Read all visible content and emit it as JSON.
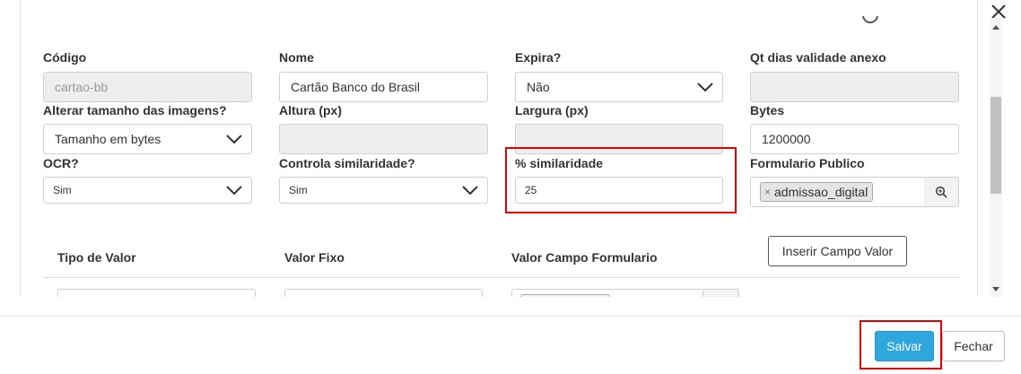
{
  "form": {
    "row1": {
      "codigo": {
        "label": "Código",
        "value": "cartao-bb"
      },
      "nome": {
        "label": "Nome",
        "value": "Cartão Banco do Brasil"
      },
      "expira": {
        "label": "Expira?",
        "value": "Não"
      },
      "qt_dias": {
        "label": "Qt dias validade anexo",
        "value": ""
      }
    },
    "row2": {
      "alterar_tamanho": {
        "label": "Alterar tamanho das imagens?",
        "value": "Tamanho em bytes"
      },
      "altura": {
        "label": "Altura (px)",
        "value": ""
      },
      "largura": {
        "label": "Largura (px)",
        "value": ""
      },
      "bytes": {
        "label": "Bytes",
        "value": "1200000"
      }
    },
    "row3": {
      "ocr": {
        "label": "OCR?",
        "value": "Sim"
      },
      "controla_similaridade": {
        "label": "Controla similaridade?",
        "value": "Sim"
      },
      "similaridade": {
        "label": "% similaridade",
        "value": "25"
      },
      "formulario_publico": {
        "label": "Formulario Publico",
        "tag_remove": "×",
        "tag": "admissao_digital"
      }
    }
  },
  "values_table": {
    "insert_button": "Inserir Campo Valor",
    "headers": [
      "Tipo de Valor",
      "Valor Fixo",
      "Valor Campo Formulario"
    ]
  },
  "footer": {
    "save": "Salvar",
    "close": "Fechar"
  },
  "colors": {
    "highlight": "#e20000",
    "primary": "#2ea8dc"
  }
}
